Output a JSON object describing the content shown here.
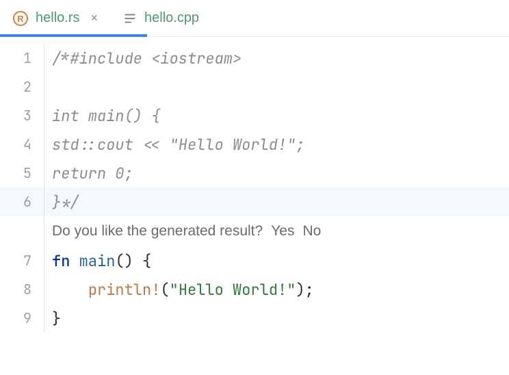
{
  "tabs": [
    {
      "label": "hello.rs",
      "icon": "rust",
      "active": true,
      "closable": true
    },
    {
      "label": "hello.cpp",
      "icon": "file",
      "active": false,
      "closable": false
    }
  ],
  "code": {
    "lines": [
      {
        "num": "1",
        "tokens": [
          {
            "cls": "c-comment",
            "t": "/*#include <iostream>"
          }
        ]
      },
      {
        "num": "2",
        "tokens": []
      },
      {
        "num": "3",
        "tokens": [
          {
            "cls": "c-comment",
            "t": "int main() {"
          }
        ]
      },
      {
        "num": "4",
        "tokens": [
          {
            "cls": "c-comment",
            "t": "std::cout << \"Hello World!\";"
          }
        ]
      },
      {
        "num": "5",
        "tokens": [
          {
            "cls": "c-comment",
            "t": "return 0;"
          }
        ]
      },
      {
        "num": "6",
        "highlighted": true,
        "tokens": [
          {
            "cls": "c-comment",
            "t": "}*/"
          }
        ]
      },
      {
        "num": "7",
        "tokens": [
          {
            "cls": "c-keyword",
            "t": "fn "
          },
          {
            "cls": "c-fn-name",
            "t": "main"
          },
          {
            "cls": "c-punct",
            "t": "() {"
          }
        ]
      },
      {
        "num": "8",
        "tokens": [
          {
            "cls": "c-punct",
            "t": "    "
          },
          {
            "cls": "c-macro",
            "t": "println!"
          },
          {
            "cls": "c-punct",
            "t": "("
          },
          {
            "cls": "c-string",
            "t": "\"Hello World!\""
          },
          {
            "cls": "c-punct",
            "t": ");"
          }
        ]
      },
      {
        "num": "9",
        "tokens": [
          {
            "cls": "c-punct",
            "t": "}"
          }
        ]
      }
    ]
  },
  "feedback": {
    "prompt": "Do you like the generated result?",
    "yes": "Yes",
    "no": "No",
    "after_line": "6"
  }
}
